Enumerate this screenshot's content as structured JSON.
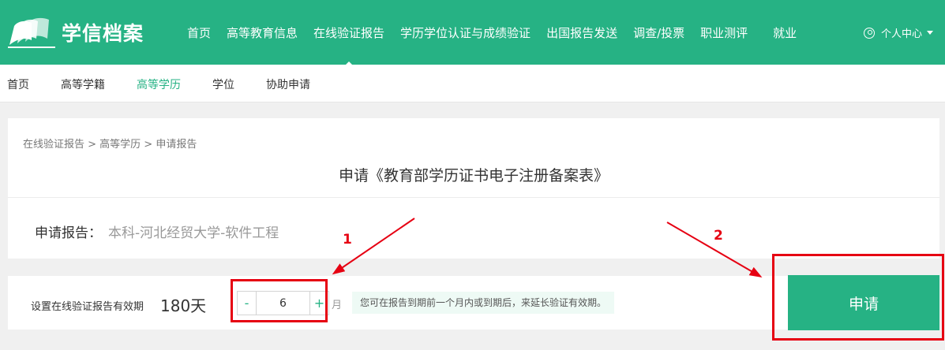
{
  "header": {
    "logo_text": "学信档案",
    "nav": [
      {
        "label": "首页"
      },
      {
        "label": "高等教育信息"
      },
      {
        "label": "在线验证报告",
        "active": true
      },
      {
        "label": "学历学位认证与成绩验证"
      },
      {
        "label": "出国报告发送"
      },
      {
        "label": "调查/投票"
      },
      {
        "label": "职业测评"
      },
      {
        "label": "就业"
      }
    ],
    "user_center": "个人中心"
  },
  "subnav": [
    {
      "label": "首页"
    },
    {
      "label": "高等学籍"
    },
    {
      "label": "高等学历",
      "active": true
    },
    {
      "label": "学位"
    },
    {
      "label": "协助申请"
    }
  ],
  "breadcrumb": "在线验证报告 > 高等学历 > 申请报告",
  "title": "申请《教育部学历证书电子注册备案表》",
  "report": {
    "label": "申请报告：",
    "value": "本科-河北经贸大学-软件工程"
  },
  "validity": {
    "label": "设置在线验证报告有效期",
    "days": "180天",
    "minus": "-",
    "value": "6",
    "plus": "+",
    "unit": "月",
    "hint": "您可在报告到期前一个月内或到期后，来延长验证有效期。"
  },
  "apply_label": "申请",
  "annotations": {
    "one": "1",
    "two": "2",
    "color": "#e60012"
  },
  "colors": {
    "brand": "#26b284",
    "hint_bg": "#eefaf5"
  }
}
